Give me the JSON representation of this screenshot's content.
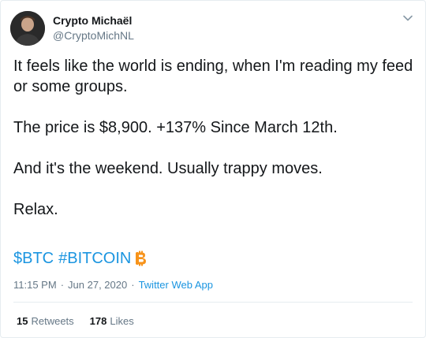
{
  "author": {
    "display_name": "Crypto Michaël",
    "handle": "@CryptoMichNL"
  },
  "tweet": {
    "paragraphs": [
      "It feels like the world is ending, when I'm reading my feed or some groups.",
      "The price is $8,900.  +137% Since March 12th.",
      "And it's the weekend. Usually trappy moves.",
      "Relax."
    ],
    "cashtag": "$BTC",
    "hashtag": "#BITCOIN",
    "emoji_icon": "bitcoin-icon"
  },
  "meta": {
    "time": "11:15 PM",
    "date": "Jun 27, 2020",
    "source": "Twitter Web App",
    "separator": "·"
  },
  "stats": {
    "retweets_count": "15",
    "retweets_label": "Retweets",
    "likes_count": "178",
    "likes_label": "Likes"
  },
  "colors": {
    "link": "#1b95e0",
    "text": "#14171a",
    "muted": "#657786",
    "bitcoin": "#f7931a"
  }
}
